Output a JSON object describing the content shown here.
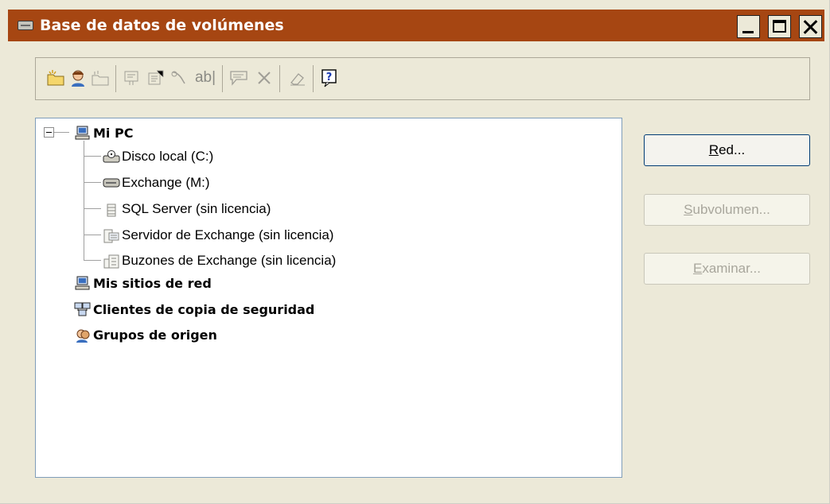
{
  "window": {
    "title": "Base de datos de volúmenes",
    "title_bar_color": "#a64612",
    "controls": [
      "minimize-icon",
      "maximize-icon",
      "close-icon"
    ]
  },
  "toolbar": {
    "icons": [
      "new-folder-icon",
      "user-icon",
      "disabled-folder-icon",
      "properties-card-icon",
      "properties-icon",
      "link-icon",
      "rename-icon",
      "comment-icon",
      "delete-icon",
      "eraser-icon",
      "help-icon"
    ]
  },
  "tree": {
    "root": {
      "label": "Mi PC",
      "icon": "computer-icon",
      "expanded": true
    },
    "children": [
      {
        "label": "Disco local (C:)",
        "icon": "local-disk-icon"
      },
      {
        "label": "Exchange (M:)",
        "icon": "drive-icon"
      },
      {
        "label": "SQL Server (sin licencia)",
        "icon": "database-icon"
      },
      {
        "label": "Servidor de Exchange (sin licencia)",
        "icon": "server-icon"
      },
      {
        "label": "Buzones de Exchange (sin licencia)",
        "icon": "mailbox-icon"
      }
    ],
    "others": [
      {
        "label": "Mis sitios de red",
        "icon": "network-places-icon"
      },
      {
        "label": "Clientes de copia de seguridad",
        "icon": "backup-clients-icon"
      },
      {
        "label": "Grupos de origen",
        "icon": "source-groups-icon"
      }
    ]
  },
  "buttons": {
    "network": {
      "accel": "R",
      "rest": "ed...",
      "enabled": true
    },
    "subvolume": {
      "accel": "S",
      "rest": "ubvolumen...",
      "enabled": false
    },
    "browse": {
      "accel": "E",
      "rest": "xaminar...",
      "enabled": false
    }
  }
}
